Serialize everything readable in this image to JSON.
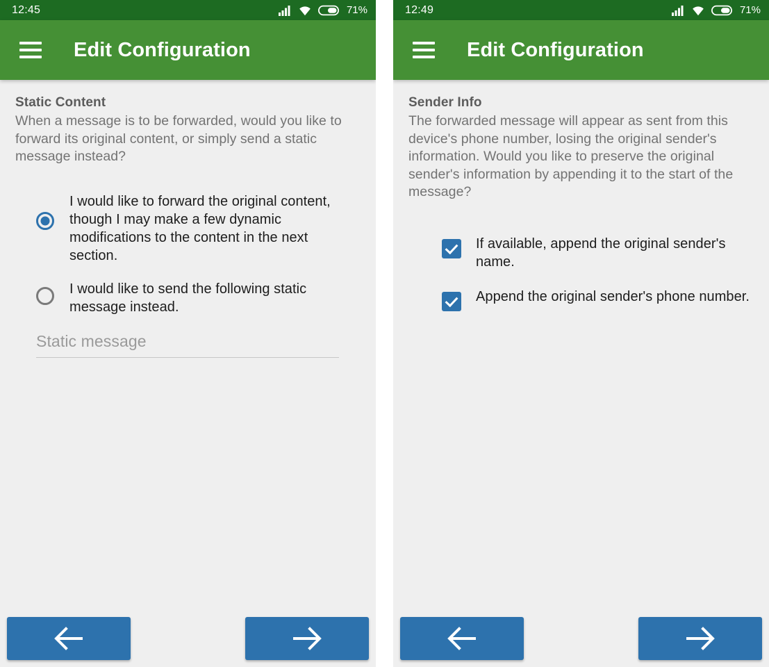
{
  "panels": [
    {
      "id": "static-content",
      "statusbar": {
        "time": "12:45",
        "battery": "71%",
        "icons": [
          "signal-icon",
          "wifi-icon",
          "battery-icon"
        ]
      },
      "appbar": {
        "menu_icon": "hamburger-menu-icon",
        "title": "Edit Configuration"
      },
      "section": {
        "title": "Static Content",
        "description": "When a message is to be forwarded, would you like to forward its original content, or simply send a static message instead?"
      },
      "radio_group": {
        "options": [
          {
            "label": "I would like to forward the original content, though I may make a few dynamic modifications to the content in the next section.",
            "checked": true
          },
          {
            "label": "I would like to send the following static message instead.",
            "checked": false
          }
        ]
      },
      "text_field": {
        "value": "",
        "placeholder": "Static message"
      },
      "nav": {
        "back_icon": "arrow-left-icon",
        "next_icon": "arrow-right-icon"
      }
    },
    {
      "id": "sender-info",
      "statusbar": {
        "time": "12:49",
        "battery": "71%",
        "icons": [
          "signal-icon",
          "wifi-icon",
          "battery-icon"
        ]
      },
      "appbar": {
        "menu_icon": "hamburger-menu-icon",
        "title": "Edit Configuration"
      },
      "section": {
        "title": "Sender Info",
        "description": "The forwarded message will appear as sent from this device's phone number, losing the original sender's information. Would you like to preserve the original sender's information by appending it to the start of the message?"
      },
      "checkboxes": [
        {
          "label": "If available, append the original sender's name.",
          "checked": true
        },
        {
          "label": "Append the original sender's phone number.",
          "checked": true
        }
      ],
      "nav": {
        "back_icon": "arrow-left-icon",
        "next_icon": "arrow-right-icon"
      }
    }
  ],
  "colors": {
    "status_bar_green": "#1d6b22",
    "app_bar_green": "#459035",
    "accent_blue": "#2d72ad",
    "content_background": "#efefef",
    "heading_gray": "#5c5c5c",
    "body_gray": "#737373",
    "option_text": "#1d1d1d"
  }
}
